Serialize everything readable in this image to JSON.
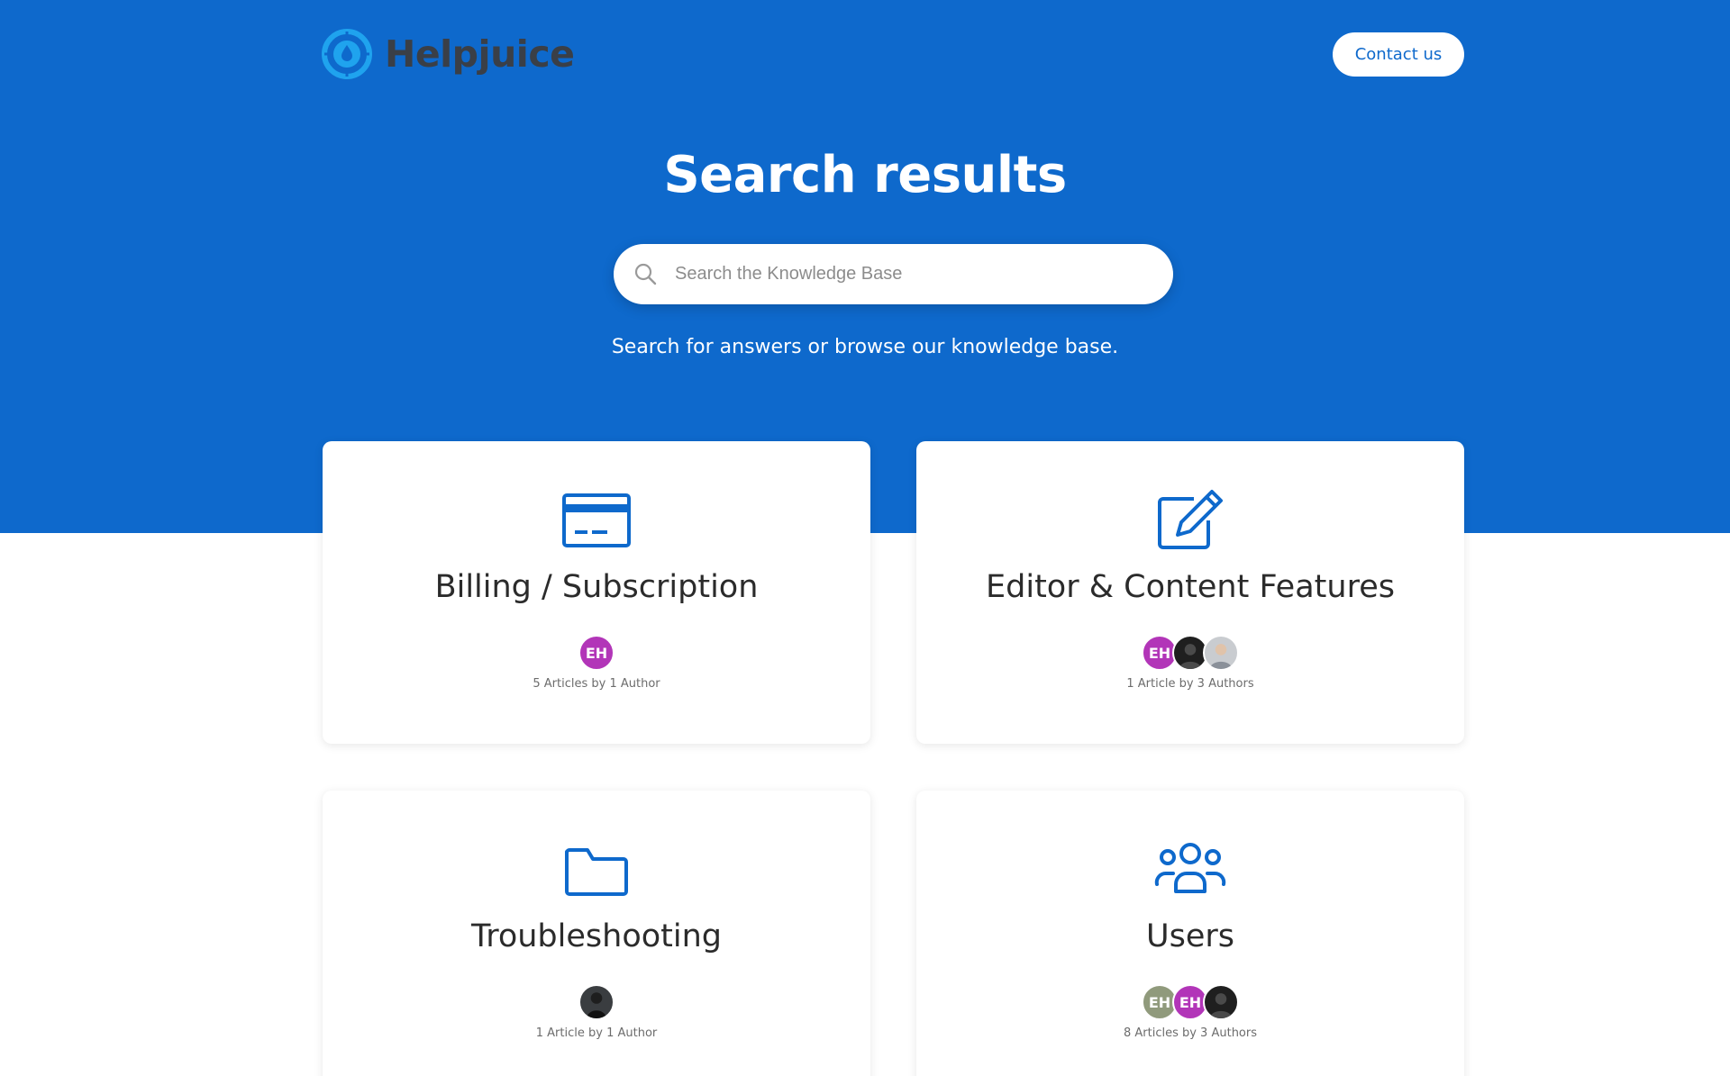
{
  "header": {
    "brand_name": "Helpjuice",
    "contact_label": "Contact us"
  },
  "hero": {
    "title": "Search results",
    "search_placeholder": "Search the Knowledge Base",
    "subtitle": "Search for answers or browse our knowledge base."
  },
  "colors": {
    "brand_blue": "#0e69cc",
    "logo_light_blue": "#1fa3ee",
    "avatar_purple": "#b235b8",
    "avatar_olive": "#909a7c"
  },
  "categories": [
    {
      "title": "Billing / Subscription",
      "icon": "credit-card-icon",
      "meta": "5 Articles by 1 Author",
      "avatars": [
        {
          "type": "initials",
          "text": "EH",
          "color": "#b235b8"
        }
      ]
    },
    {
      "title": "Editor & Content Features",
      "icon": "edit-icon",
      "meta": "1 Article by 3 Authors",
      "avatars": [
        {
          "type": "initials",
          "text": "EH",
          "color": "#b235b8"
        },
        {
          "type": "photo",
          "tone": "dark"
        },
        {
          "type": "photo",
          "tone": "light"
        }
      ]
    },
    {
      "title": "Troubleshooting",
      "icon": "folder-icon",
      "meta": "1 Article by 1 Author",
      "avatars": [
        {
          "type": "photo",
          "tone": "dark"
        }
      ]
    },
    {
      "title": "Users",
      "icon": "users-icon",
      "meta": "8 Articles by 3 Authors",
      "avatars": [
        {
          "type": "initials",
          "text": "EH",
          "color": "#909a7c"
        },
        {
          "type": "initials",
          "text": "EH",
          "color": "#b235b8"
        },
        {
          "type": "photo",
          "tone": "dark"
        }
      ]
    }
  ]
}
